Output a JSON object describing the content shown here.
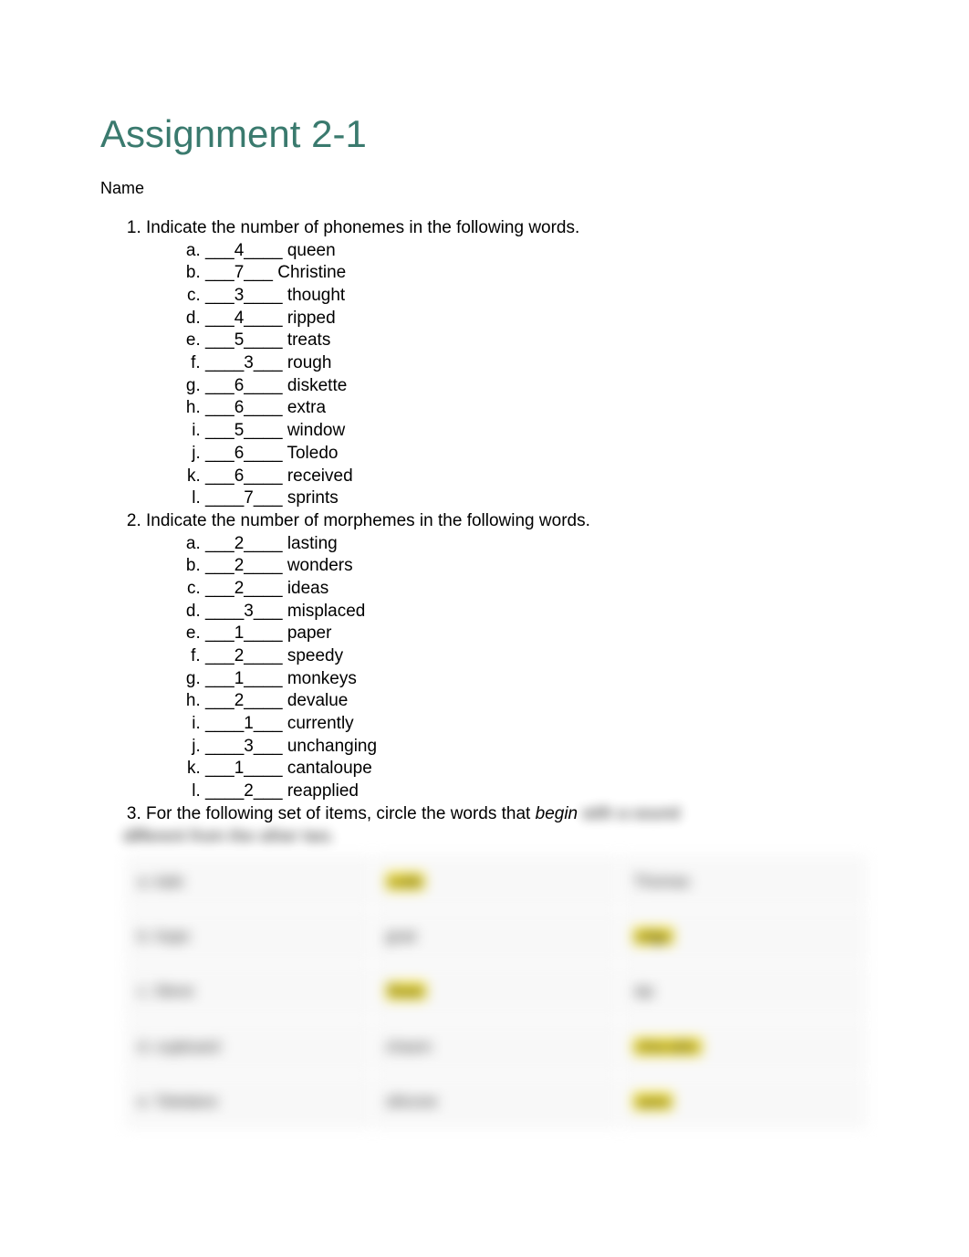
{
  "title": "Assignment 2-1",
  "name_label": "Name",
  "questions": {
    "q1": {
      "prompt": "Indicate the number of phonemes in the following words.",
      "items": [
        {
          "ans": "4",
          "word": "queen",
          "pre": "___",
          "post": "____"
        },
        {
          "ans": "7",
          "word": "Christine",
          "pre": "___",
          "post": "___"
        },
        {
          "ans": "3",
          "word": "thought",
          "pre": "___",
          "post": "____"
        },
        {
          "ans": "4",
          "word": "ripped",
          "pre": "___",
          "post": "____"
        },
        {
          "ans": "5",
          "word": "treats",
          "pre": "___",
          "post": "____"
        },
        {
          "ans": "3",
          "word": "rough",
          "pre": "____",
          "post": "___"
        },
        {
          "ans": "6",
          "word": "diskette",
          "pre": "___",
          "post": "____"
        },
        {
          "ans": "6",
          "word": "extra",
          "pre": "___",
          "post": "____"
        },
        {
          "ans": "5",
          "word": "window",
          "pre": "___",
          "post": "____"
        },
        {
          "ans": "6",
          "word": "Toledo",
          "pre": "___",
          "post": "____"
        },
        {
          "ans": "6",
          "word": "received",
          "pre": "___",
          "post": "____"
        },
        {
          "ans": "7",
          "word": "sprints",
          "pre": "____",
          "post": "___"
        }
      ]
    },
    "q2": {
      "prompt": "Indicate the number of morphemes in the following words.",
      "items": [
        {
          "ans": "2",
          "word": "lasting",
          "pre": "___",
          "post": "____"
        },
        {
          "ans": "2",
          "word": "wonders",
          "pre": "___",
          "post": "____"
        },
        {
          "ans": "2",
          "word": "ideas",
          "pre": "___",
          "post": "____"
        },
        {
          "ans": "3",
          "word": "misplaced",
          "pre": "____",
          "post": "___"
        },
        {
          "ans": "1",
          "word": "paper",
          "pre": "___",
          "post": "____"
        },
        {
          "ans": "2",
          "word": "speedy",
          "pre": "___",
          "post": "____"
        },
        {
          "ans": "1",
          "word": "monkeys",
          "pre": "___",
          "post": "____"
        },
        {
          "ans": "2",
          "word": "devalue",
          "pre": "___",
          "post": "____"
        },
        {
          "ans": "1",
          "word": "currently",
          "pre": "____",
          "post": "___"
        },
        {
          "ans": "3",
          "word": "unchanging",
          "pre": "____",
          "post": "___"
        },
        {
          "ans": "1",
          "word": "cantaloupe",
          "pre": "___",
          "post": "____"
        },
        {
          "ans": "2",
          "word": "reapplied",
          "pre": "____",
          "post": "___"
        }
      ]
    },
    "q3": {
      "prompt_a": "For the following set of items, circle the words that ",
      "prompt_italic": "begin",
      "prompt_tail": " with a sound",
      "blur_line": "different from the other two.",
      "rows": [
        {
          "c1": "a. kale",
          "c2": "cede",
          "c2hl": true,
          "c3": "Thomas",
          "c3hl": false
        },
        {
          "c1": "b. hope",
          "c2": "gnat",
          "c2hl": false,
          "c3": "edge",
          "c3hl": true
        },
        {
          "c1": "c. Steve",
          "c2": "Sean",
          "c2hl": true,
          "c3": "sip",
          "c3hl": false
        },
        {
          "c1": "d. cupboard",
          "c2": "chasm",
          "c2hl": false,
          "c3": "cherubic",
          "c3hl": true
        },
        {
          "c1": "e. Toledano",
          "c2": "silicone",
          "c2hl": false,
          "c3": "sane",
          "c3hl": true
        }
      ]
    }
  }
}
